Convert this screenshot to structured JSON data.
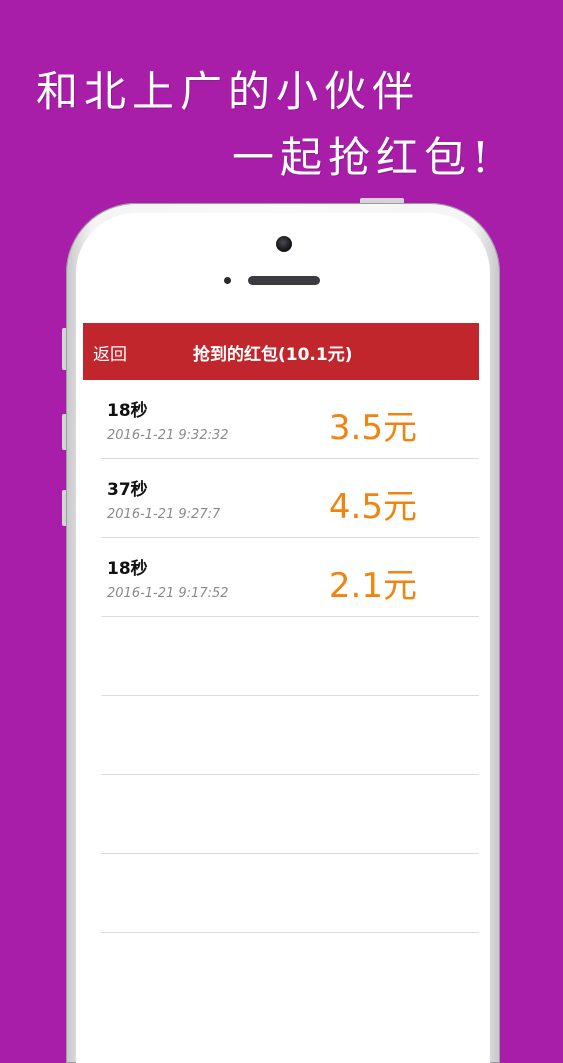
{
  "promo": {
    "line1": "和北上广的小伙伴",
    "line2": "一起抢红包!"
  },
  "app": {
    "back_label": "返回",
    "title": "抢到的红包(10.1元)",
    "theme_color": "#c1262c",
    "amount_color": "#f0840f"
  },
  "records": [
    {
      "duration": "18秒",
      "time": "2016-1-21 9:32:32",
      "amount": "3.5元"
    },
    {
      "duration": "37秒",
      "time": "2016-1-21 9:27:7",
      "amount": "4.5元"
    },
    {
      "duration": "18秒",
      "time": "2016-1-21 9:17:52",
      "amount": "2.1元"
    }
  ]
}
